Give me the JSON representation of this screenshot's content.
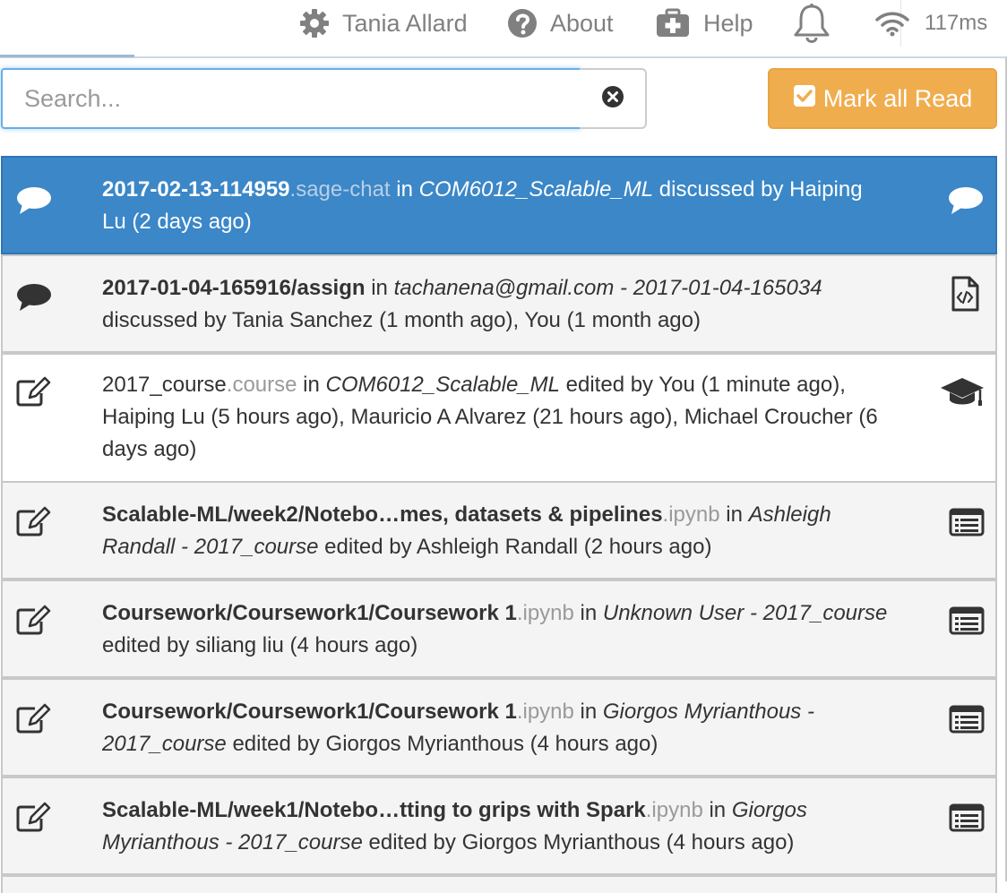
{
  "topbar": {
    "user": "Tania Allard",
    "about": "About",
    "help": "Help",
    "ping": "117ms",
    "icons": [
      "gear-icon",
      "question-circle-icon",
      "medkit-icon",
      "bell-icon",
      "wifi-icon"
    ]
  },
  "search": {
    "placeholder": "Search...",
    "value": ""
  },
  "mark_all_read": "Mark all Read",
  "colors": {
    "active_row": "#3b87c8",
    "mark_read_button": "#f0ad4e",
    "muted_text": "#9a9a9a"
  },
  "notifications": [
    {
      "lead_icon": "comment-icon",
      "trail_icon": "comment-icon",
      "title": "2017-02-13-114959",
      "ext": ".sage-chat",
      "in_word": " in ",
      "project": "COM6012_Scalable_ML",
      "action": " discussed by Haiping Lu (2 days ago)"
    },
    {
      "lead_icon": "comment-icon",
      "trail_icon": "file-code-icon",
      "title": "2017-01-04-165916/assign",
      "ext": "",
      "in_word": " in ",
      "project": "tachanena@gmail.com - 2017-01-04-165034",
      "action": " discussed by Tania Sanchez (1 month ago), You (1 month ago)"
    },
    {
      "lead_icon": "edit-icon",
      "trail_icon": "graduation-cap-icon",
      "title": "2017_course",
      "ext": ".course",
      "in_word": " in ",
      "project": "COM6012_Scalable_ML",
      "action": " edited by You (1 minute ago), Haiping Lu (5 hours ago), Mauricio A Alvarez (21 hours ago), Michael Croucher (6 days ago)"
    },
    {
      "lead_icon": "edit-icon",
      "trail_icon": "list-alt-icon",
      "title": "Scalable-ML/week2/Notebo…mes, datasets & pipelines",
      "ext": ".ipynb",
      "in_word": " in ",
      "project": "Ashleigh Randall - 2017_course",
      "action": " edited by Ashleigh Randall (2 hours ago)"
    },
    {
      "lead_icon": "edit-icon",
      "trail_icon": "list-alt-icon",
      "title": "Coursework/Coursework1/Coursework 1",
      "ext": ".ipynb",
      "in_word": " in ",
      "project": "Unknown User - 2017_course",
      "action": " edited by siliang liu (4 hours ago)"
    },
    {
      "lead_icon": "edit-icon",
      "trail_icon": "list-alt-icon",
      "title": "Coursework/Coursework1/Coursework 1",
      "ext": ".ipynb",
      "in_word": " in ",
      "project": "Giorgos Myrianthous - 2017_course",
      "action": " edited by Giorgos Myrianthous (4 hours ago)"
    },
    {
      "lead_icon": "edit-icon",
      "trail_icon": "list-alt-icon",
      "title": "Scalable-ML/week1/Notebo…tting to grips with Spark",
      "ext": ".ipynb",
      "in_word": " in ",
      "project": "Giorgos Myrianthous - 2017_course",
      "action": " edited by Giorgos Myrianthous (4 hours ago)"
    }
  ]
}
